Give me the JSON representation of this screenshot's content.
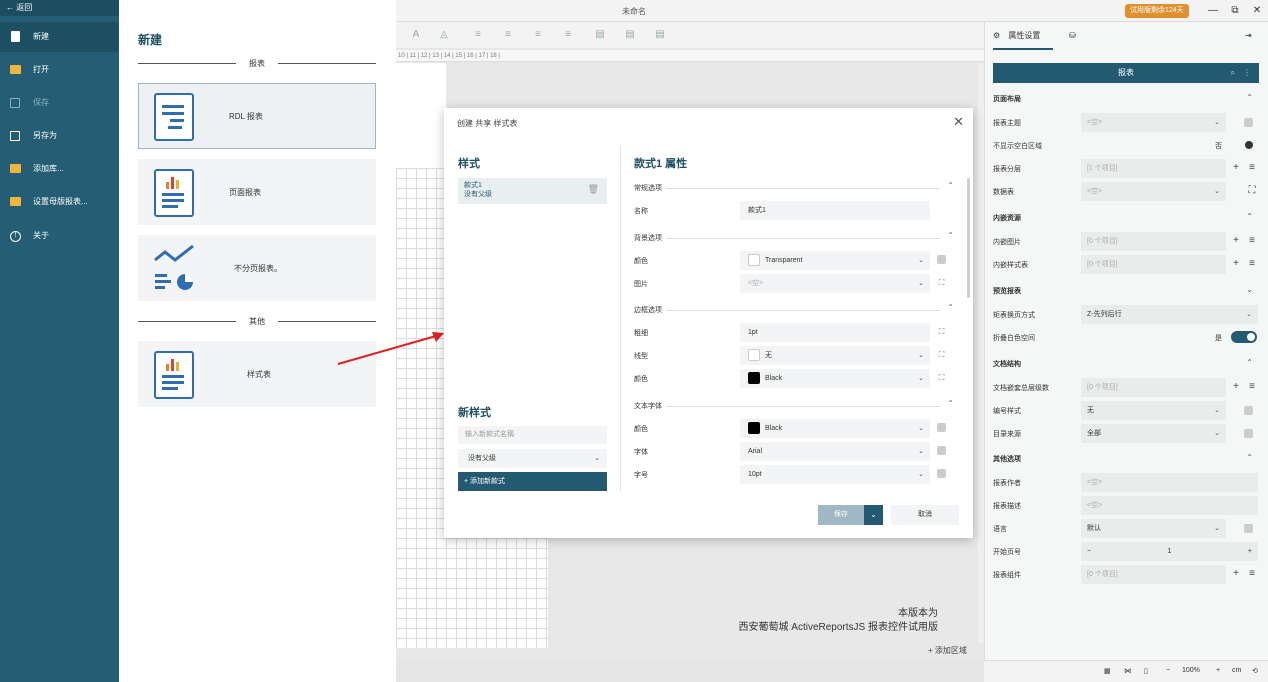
{
  "window": {
    "title": "未命名",
    "trial_badge": "试用版剩余124天",
    "minimize": "—",
    "restore": "⧉",
    "close": "✕"
  },
  "ruler": {
    "ticks": "10 | 11 | 12 | 13 | 14 | 15 | 16 | 17 | 18 |"
  },
  "canvas": {
    "watermark_line1": "本版本为",
    "watermark_line2": "西安葡萄城 ActiveReportsJS 报表控件试用版",
    "add_region": "+ 添加区域"
  },
  "statusbar": {
    "minus": "−",
    "zoom": "100%",
    "plus": "+",
    "unit": "cm"
  },
  "sidebar": {
    "back": "← 返回",
    "items": [
      {
        "label": "新建",
        "icon": "new-file-icon",
        "active": true
      },
      {
        "label": "打开",
        "icon": "folder-icon"
      },
      {
        "label": "保存",
        "icon": "save-icon",
        "disabled": true
      },
      {
        "label": "另存为",
        "icon": "save-as-icon"
      },
      {
        "label": "添加库...",
        "icon": "folder-icon"
      },
      {
        "label": "设置母版报表...",
        "icon": "folder-icon"
      },
      {
        "label": "关于",
        "icon": "info-icon"
      }
    ]
  },
  "newpanel": {
    "title": "新建",
    "section_reports": "报表",
    "section_other": "其他",
    "cards": [
      {
        "label": "RDL 报表",
        "icon": "rdl-report-icon"
      },
      {
        "label": "页面报表",
        "icon": "page-report-icon"
      },
      {
        "label": "不分页报表。",
        "icon": "continuous-report-icon"
      },
      {
        "label": "样式表",
        "icon": "stylesheet-icon"
      }
    ]
  },
  "dialog": {
    "title": "创建 共享 样式表",
    "styles_heading": "样式",
    "style_item_name": "款式1",
    "style_item_parent": "没有父级",
    "new_style_heading": "新样式",
    "new_style_placeholder": "输入新款式名稱",
    "parent_select": "没有父级",
    "add_button": "+ 添加新款式",
    "props_heading": "款式1 属性",
    "groups": {
      "general": "常规选项",
      "background": "背景选项",
      "border": "边框选项",
      "font": "文本字体"
    },
    "rows": {
      "name_k": "名称",
      "name_v": "款式1",
      "bgcolor_k": "颜色",
      "bgcolor_v": "Transparent",
      "image_k": "图片",
      "image_v": "<空>",
      "width_k": "粗细",
      "width_v": "1pt",
      "linestyle_k": "线型",
      "linestyle_v": "无",
      "bordercolor_k": "颜色",
      "bordercolor_v": "Black",
      "fontcolor_k": "颜色",
      "fontcolor_v": "Black",
      "font_k": "字体",
      "font_v": "Arial",
      "size_k": "字号",
      "size_v": "10pt"
    },
    "save": "保存",
    "cancel": "取消"
  },
  "rpanel": {
    "tab_props": "属性设置",
    "header": "报表",
    "sections": {
      "layout": "页面布局",
      "embedded": "内嵌资源",
      "preview": "预览报表",
      "docstruct": "文档结构",
      "other": "其他选项"
    },
    "rows": {
      "theme_k": "报表主题",
      "theme_v": "<空>",
      "noblank_k": "不显示空白区域",
      "noblank_t": "否",
      "layers_k": "报表分层",
      "layers_v": "[1 个项目]",
      "dataset_k": "数据表",
      "dataset_v": "<空>",
      "images_k": "内嵌图片",
      "images_v": "[0 个项目]",
      "styles_k": "内嵌样式表",
      "styles_v": "[0 个项目]",
      "pageorder_k": "矩表换页方式",
      "pageorder_v": "Z-先列后行",
      "collapse_k": "折叠白色空间",
      "collapse_t": "是",
      "toclevels_k": "文档嵌套总层级数",
      "toclevels_v": "[0 个项目]",
      "numstyle_k": "编号样式",
      "numstyle_v": "无",
      "tocsource_k": "目录来源",
      "tocsource_v": "全部",
      "author_k": "报表作者",
      "author_v": "<空>",
      "desc_k": "报表描述",
      "desc_v": "<空>",
      "lang_k": "语言",
      "lang_v": "默认",
      "startpage_k": "开始页号",
      "startpage_v": "1",
      "components_k": "报表组件",
      "components_v": "[0 个项目]"
    }
  }
}
